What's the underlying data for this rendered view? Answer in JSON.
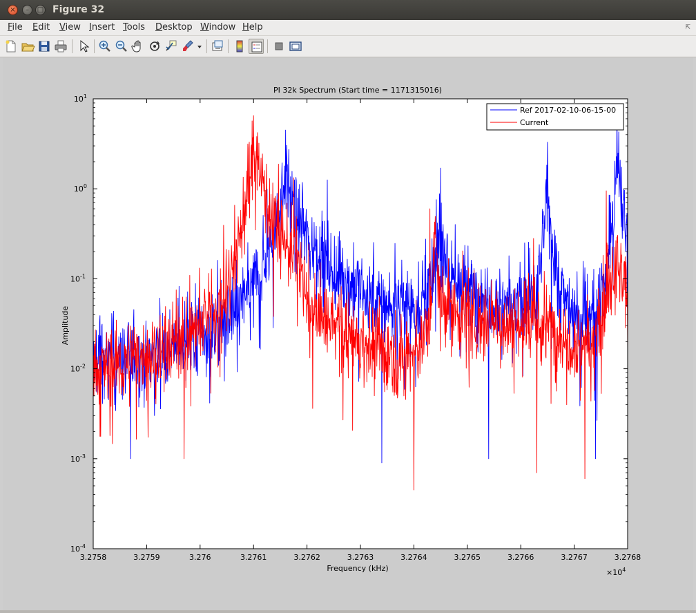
{
  "window": {
    "title": "Figure 32",
    "close_glyph": "×",
    "minimize_glyph": "–",
    "maximize_glyph": "□"
  },
  "menu": {
    "items": [
      {
        "pre": "",
        "accel": "F",
        "post": "ile"
      },
      {
        "pre": "",
        "accel": "E",
        "post": "dit"
      },
      {
        "pre": "",
        "accel": "V",
        "post": "iew"
      },
      {
        "pre": "",
        "accel": "I",
        "post": "nsert"
      },
      {
        "pre": "",
        "accel": "T",
        "post": "ools"
      },
      {
        "pre": "",
        "accel": "D",
        "post": "esktop"
      },
      {
        "pre": "",
        "accel": "W",
        "post": "indow"
      },
      {
        "pre": "",
        "accel": "H",
        "post": "elp"
      }
    ],
    "overflow_glyph": "⇱"
  },
  "toolbar": {
    "icons": [
      "new-figure-icon",
      "open-file-icon",
      "save-icon",
      "print-icon",
      "edit-plot-pointer-icon",
      "zoom-in-icon",
      "zoom-out-icon",
      "pan-hand-icon",
      "rotate-3d-icon",
      "data-cursor-icon",
      "brush-icon",
      "brush-dropdown-icon",
      "link-plot-icon",
      "colorbar-icon",
      "legend-icon",
      "hide-plot-tools-icon",
      "show-plot-tools-icon"
    ],
    "pressed": [
      "legend-icon"
    ]
  },
  "chart_data": {
    "type": "line",
    "title": "PI 32k Spectrum (Start time = 1171315016)",
    "xlabel": "Frequency (kHz)",
    "ylabel": "Amplitude",
    "x_multiplier": "×10",
    "x_multiplier_exp": "4",
    "xlim": [
      3.2758,
      3.2768
    ],
    "xticks": [
      "3.2758",
      "3.2759",
      "3.276",
      "3.2761",
      "3.2762",
      "3.2763",
      "3.2764",
      "3.2765",
      "3.2766",
      "3.2767",
      "3.2768"
    ],
    "yscale": "log",
    "ylim": [
      0.0001,
      10
    ],
    "yticks": [
      {
        "base": "10",
        "exp": "1"
      },
      {
        "base": "10",
        "exp": "0"
      },
      {
        "base": "10",
        "exp": "-1"
      },
      {
        "base": "10",
        "exp": "-2"
      },
      {
        "base": "10",
        "exp": "-3"
      },
      {
        "base": "10",
        "exp": "-4"
      }
    ],
    "grid": false,
    "legend_position": "top-right",
    "series": [
      {
        "name": "Ref 2017-02-10-06-15-00",
        "color": "#0000ff",
        "x": [
          3.2758,
          3.27585,
          3.2759,
          3.27595,
          3.276,
          3.27603,
          3.27606,
          3.27609,
          3.27612,
          3.27614,
          3.27616,
          3.27618,
          3.2762,
          3.27625,
          3.2763,
          3.27635,
          3.2764,
          3.27643,
          3.27645,
          3.27647,
          3.2765,
          3.27655,
          3.2766,
          3.27663,
          3.27665,
          3.27667,
          3.2767,
          3.27674,
          3.27676,
          3.27678,
          3.2768
        ],
        "y": [
          0.012,
          0.013,
          0.014,
          0.017,
          0.022,
          0.028,
          0.04,
          0.07,
          0.15,
          0.35,
          1.5,
          0.5,
          0.3,
          0.12,
          0.07,
          0.05,
          0.05,
          0.07,
          0.4,
          0.1,
          0.08,
          0.06,
          0.05,
          0.06,
          0.8,
          0.08,
          0.04,
          0.04,
          0.1,
          1.5,
          0.25
        ],
        "spikes": [
          {
            "x": 3.27616,
            "y": 4.5
          },
          {
            "x": 3.27645,
            "y": 1.7
          },
          {
            "x": 3.27665,
            "y": 3.3
          },
          {
            "x": 3.27678,
            "y": 8.0
          }
        ],
        "dips": [
          {
            "x": 3.27587,
            "y": 0.001
          },
          {
            "x": 3.27634,
            "y": 0.0009
          },
          {
            "x": 3.27654,
            "y": 0.001
          },
          {
            "x": 3.27674,
            "y": 0.001
          }
        ]
      },
      {
        "name": "Current",
        "color": "#ff0000",
        "x": [
          3.2758,
          3.27585,
          3.2759,
          3.27595,
          3.276,
          3.27603,
          3.27605,
          3.27607,
          3.27609,
          3.2761,
          3.27612,
          3.27615,
          3.27618,
          3.2762,
          3.27625,
          3.2763,
          3.27635,
          3.2764,
          3.27643,
          3.27644,
          3.27645,
          3.2765,
          3.27655,
          3.2766,
          3.27665,
          3.2767,
          3.27674,
          3.27676,
          3.27678,
          3.2768
        ],
        "y": [
          0.01,
          0.011,
          0.014,
          0.02,
          0.03,
          0.05,
          0.09,
          0.2,
          1.0,
          3.0,
          1.0,
          0.3,
          0.2,
          0.05,
          0.03,
          0.02,
          0.015,
          0.015,
          0.03,
          0.3,
          0.05,
          0.04,
          0.035,
          0.03,
          0.03,
          0.02,
          0.02,
          0.05,
          0.15,
          0.05
        ],
        "spikes": [
          {
            "x": 3.2761,
            "y": 6.5
          },
          {
            "x": 3.27643,
            "y": 0.6
          },
          {
            "x": 3.27676,
            "y": 0.95
          }
        ],
        "dips": [
          {
            "x": 3.27597,
            "y": 0.001
          },
          {
            "x": 3.2764,
            "y": 0.00045
          },
          {
            "x": 3.27663,
            "y": 0.0007
          },
          {
            "x": 3.27672,
            "y": 0.0006
          }
        ]
      }
    ]
  }
}
